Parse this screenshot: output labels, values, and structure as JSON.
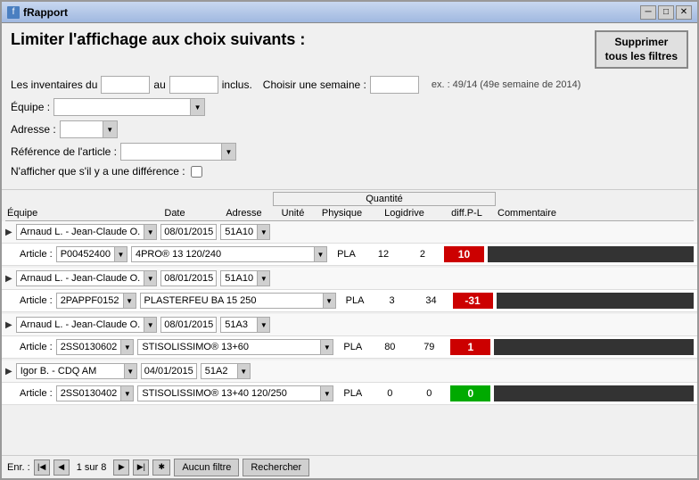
{
  "window": {
    "title": "fRapport",
    "icon": "f"
  },
  "filter": {
    "title": "Limiter l'affichage aux choix suivants :",
    "delete_btn": "Supprimer\ntous les filtres",
    "inventaires_label": "Les inventaires du",
    "au_label": "au",
    "inclus_label": "inclus.",
    "semaine_label": "Choisir une semaine :",
    "equipe_label": "Équipe :",
    "adresse_label": "Adresse :",
    "reference_label": "Référence de l'article :",
    "difference_label": "N'afficher que s'il y a une différence :",
    "week_example": "ex. : 49/14 (49e semaine de 2014)"
  },
  "table": {
    "qty_header": "Quantité",
    "col_equipe": "Équipe",
    "col_date": "Date",
    "col_adresse": "Adresse",
    "col_unite": "Unité",
    "col_physique": "Physique",
    "col_logidrive": "Logidrive",
    "col_diff": "diff.P-L",
    "col_commentaire": "Commentaire"
  },
  "rows": [
    {
      "group_name": "Arnaud L. - Jean-Claude O.",
      "date": "08/01/2015",
      "address": "51A10",
      "article_code": "P00452400",
      "article_desc": "4PRO® 13 120/240",
      "unite": "PLA",
      "physique": "12",
      "logidrive": "2",
      "diff": "10",
      "diff_type": "red"
    },
    {
      "group_name": "Arnaud L. - Jean-Claude O.",
      "date": "08/01/2015",
      "address": "51A10",
      "article_code": "2PAPPF0152",
      "article_desc": "PLASTERFEU BA 15 250",
      "unite": "PLA",
      "physique": "3",
      "logidrive": "34",
      "diff": "-31",
      "diff_type": "red"
    },
    {
      "group_name": "Arnaud L. - Jean-Claude O.",
      "date": "08/01/2015",
      "address": "51A3",
      "article_code": "2SS0130602",
      "article_desc": "STISOLISSIMO® 13+60",
      "unite": "PLA",
      "physique": "80",
      "logidrive": "79",
      "diff": "1",
      "diff_type": "red"
    },
    {
      "group_name": "Igor B. - CDQ AM",
      "date": "04/01/2015",
      "address": "51A2",
      "article_code": "2SS0130402",
      "article_desc": "STISOLISSIMO® 13+40 120/250",
      "unite": "PLA",
      "physique": "0",
      "logidrive": "0",
      "diff": "0",
      "diff_type": "green"
    }
  ],
  "bottom": {
    "enr_label": "Enr. :",
    "page_info": "1 sur 8",
    "aucun_filtre_btn": "Aucun filtre",
    "rechercher_btn": "Rechercher"
  }
}
